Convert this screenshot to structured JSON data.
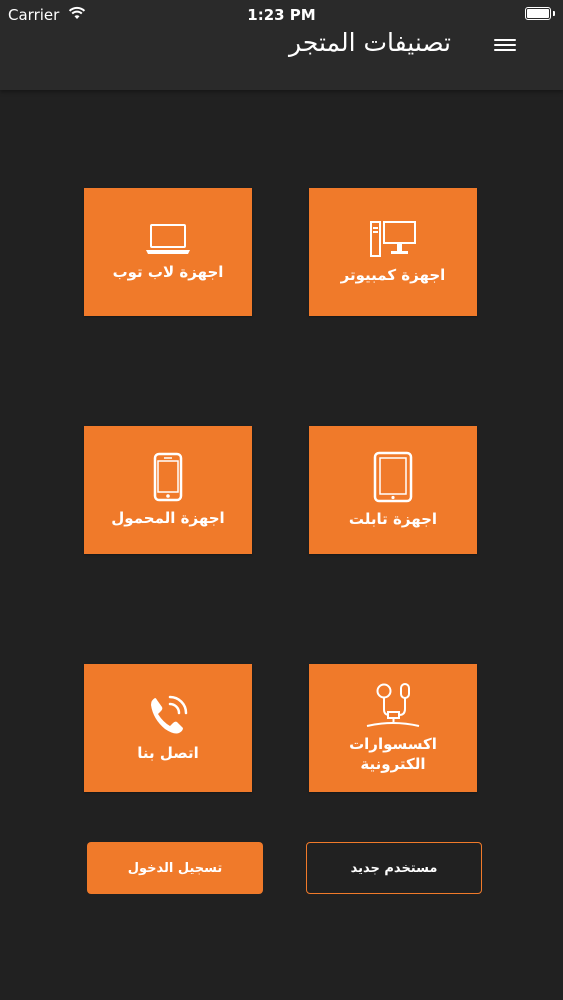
{
  "status_bar": {
    "carrier": "Carrier",
    "time": "1:23 PM"
  },
  "header": {
    "title": "تصنيفات المتجر"
  },
  "tiles": [
    {
      "label": "اجهزة كمبيوتر",
      "icon": "desktop-computer-icon"
    },
    {
      "label": "اجهزة لاب توب",
      "icon": "laptop-icon"
    },
    {
      "label": "اجهزة تابلت",
      "icon": "tablet-icon"
    },
    {
      "label": "اجهزة المحمول",
      "icon": "mobile-phone-icon"
    },
    {
      "label": "اكسسوارات الكترونية",
      "icon": "earphones-icon"
    },
    {
      "label": "اتصل بنا",
      "icon": "phone-call-icon"
    }
  ],
  "buttons": {
    "login": "تسجيل الدخول",
    "new_user": "مستخدم جديد"
  },
  "colors": {
    "accent": "#f07a2a",
    "background": "#212121",
    "header": "#2a2a2a"
  }
}
